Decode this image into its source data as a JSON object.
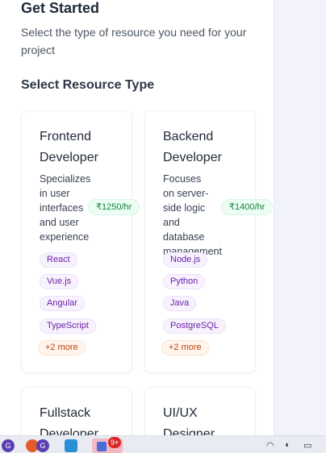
{
  "header": {
    "title": "Get Started",
    "subtitle": "Select the type of resource you need for your project",
    "section_title": "Select Resource Type"
  },
  "cards": [
    {
      "title": "Frontend Developer",
      "description": "Specializes in user interfaces and user experience",
      "rate": "₹1250/hr",
      "tags": [
        "React",
        "Vue.js",
        "Angular",
        "TypeScript"
      ],
      "more": "+2 more"
    },
    {
      "title": "Backend Developer",
      "description": "Focuses on server-side logic and database management",
      "rate": "₹1400/hr",
      "tags": [
        "Node.js",
        "Python",
        "Java",
        "PostgreSQL"
      ],
      "more": "+2 more"
    },
    {
      "title": "Fullstack Developer"
    },
    {
      "title": "UI/UX Designer"
    }
  ],
  "taskbar": {
    "notification_badge": "9+",
    "app_letter_1": "G",
    "app_letter_2": "G"
  },
  "colors": {
    "rate_green": "#15803d",
    "tag_purple": "#6b21a8",
    "more_orange": "#c2410c"
  }
}
